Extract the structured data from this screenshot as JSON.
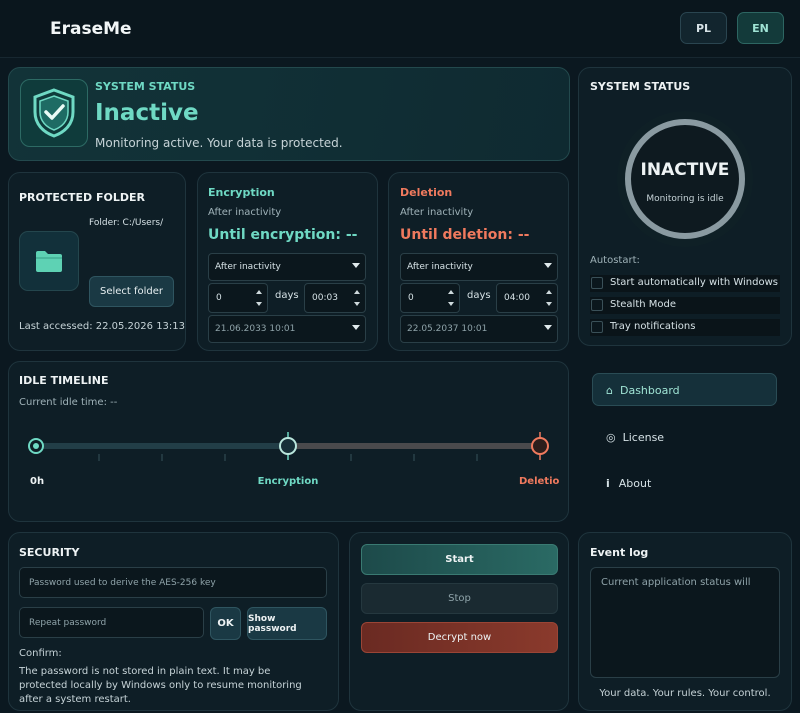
{
  "app": {
    "title": "EraseMe"
  },
  "lang": {
    "pl": "PL",
    "en": "EN"
  },
  "hero": {
    "eyebrow": "SYSTEM STATUS",
    "status": "Inactive",
    "message": "Monitoring active. Your data is protected."
  },
  "status_panel": {
    "title": "SYSTEM STATUS",
    "gauge_label": "INACTIVE",
    "gauge_sub": "Monitoring is idle",
    "autostart_label": "Autostart:",
    "options": [
      {
        "label": "Start automatically with Windows",
        "checked": false
      },
      {
        "label": "Stealth Mode",
        "checked": false
      },
      {
        "label": "Tray notifications",
        "checked": false
      }
    ]
  },
  "folder": {
    "title": "PROTECTED FOLDER",
    "path": "Folder: C:/Users/",
    "select_button": "Select folder",
    "last_accessed": "Last accessed: 22.05.2026 13:13"
  },
  "encryption": {
    "title": "Encryption",
    "subtitle": "After inactivity",
    "countdown": "Until encryption: --",
    "mode": "After inactivity",
    "days_value": "0",
    "days_label": "days",
    "time_value": "00:03",
    "date_value": "21.06.2033 10:01",
    "accent": "#6fd9c4"
  },
  "deletion": {
    "title": "Deletion",
    "subtitle": "After inactivity",
    "countdown": "Until deletion: --",
    "mode": "After inactivity",
    "days_value": "0",
    "days_label": "days",
    "time_value": "04:00",
    "date_value": "22.05.2037 10:01",
    "accent": "#f07a5e"
  },
  "timeline": {
    "title": "IDLE TIMELINE",
    "current": "Current idle time: --",
    "label_start": "0h",
    "label_mid": "Encryption",
    "label_end": "Deletion"
  },
  "nav": {
    "items": [
      {
        "label": "Dashboard",
        "icon": "home-icon",
        "glyph": "⌂",
        "active": true
      },
      {
        "label": "License",
        "icon": "eye-icon",
        "glyph": "◎",
        "active": false
      },
      {
        "label": "About",
        "icon": "info-icon",
        "glyph": "i",
        "active": false
      }
    ]
  },
  "security": {
    "title": "SECURITY",
    "password_placeholder": "Password used to derive the AES-256 key",
    "repeat_placeholder": "Repeat password",
    "ok_button": "OK",
    "show_button": "Show password",
    "confirm_label": "Confirm:",
    "note": "The password is not stored in plain text. It may be protected locally by Windows only to resume monitoring after a system restart."
  },
  "actions": {
    "start": "Start",
    "stop": "Stop",
    "decrypt": "Decrypt now"
  },
  "event_log": {
    "title": "Event log",
    "text": "Current application status will",
    "footer": "Your data. Your rules. Your control."
  },
  "colors": {
    "teal": "#6fd9c4",
    "coral": "#f07a5e",
    "background": "#0b1820"
  }
}
